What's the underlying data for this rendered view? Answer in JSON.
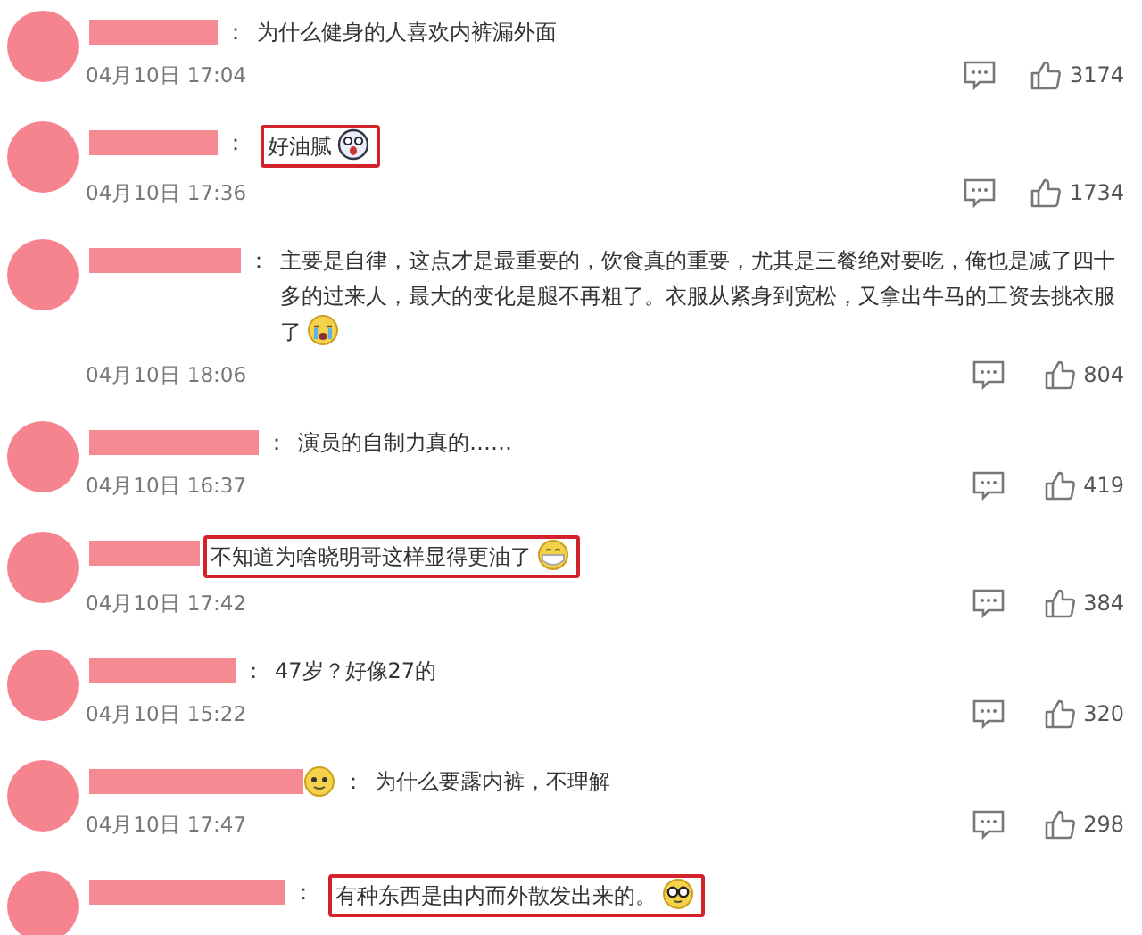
{
  "comments": [
    {
      "name_emoji": false,
      "colon": "：",
      "text": "为什么健身的人喜欢内裤漏外面",
      "emoji": false,
      "highlighted": false,
      "date": "04月10日 17:04",
      "likes": "3174"
    },
    {
      "name_emoji": false,
      "colon": "：",
      "text": "好油腻",
      "emoji": true,
      "highlighted": true,
      "date": "04月10日 17:36",
      "likes": "1734"
    },
    {
      "name_emoji": false,
      "colon": "：",
      "text": "主要是自律，这点才是最重要的，饮食真的重要，尤其是三餐绝对要吃，俺也是减了四十多的过来人，最大的变化是腿不再粗了。衣服从紧身到宽松，又拿出牛马的工资去挑衣服了",
      "emoji": true,
      "highlighted": false,
      "date": "04月10日 18:06",
      "likes": "804"
    },
    {
      "name_emoji": false,
      "colon": "：",
      "text": "演员的自制力真的……",
      "emoji": false,
      "highlighted": false,
      "date": "04月10日 16:37",
      "likes": "419"
    },
    {
      "name_emoji": false,
      "text": "不知道为啥晓明哥这样显得更油了",
      "emoji": true,
      "highlighted": true,
      "date": "04月10日 17:42",
      "likes": "384"
    },
    {
      "name_emoji": false,
      "colon": "：",
      "text": "47岁？好像27的",
      "emoji": false,
      "highlighted": false,
      "date": "04月10日 15:22",
      "likes": "320"
    },
    {
      "name_emoji": true,
      "colon": "：",
      "text": "为什么要露内裤，不理解",
      "emoji": false,
      "highlighted": false,
      "date": "04月10日 17:47",
      "likes": "298"
    },
    {
      "name_emoji": false,
      "colon": "：",
      "text": "有种东西是由内而外散发出来的。",
      "emoji": true,
      "highlighted": true
    }
  ]
}
